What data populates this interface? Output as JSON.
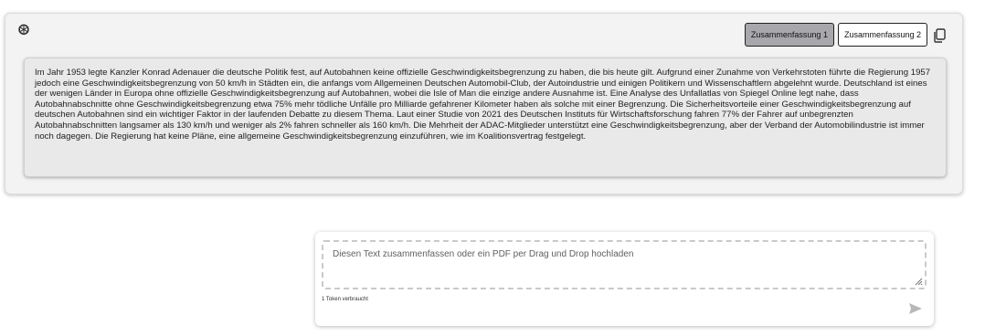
{
  "header": {
    "logo_icon": "openai-logo-icon",
    "tabs": [
      {
        "label": "Zusammenfassung 1",
        "active": true
      },
      {
        "label": "Zusammenfassung 2",
        "active": false
      }
    ],
    "copy_icon": "copy-icon"
  },
  "summary": {
    "text": "Im Jahr 1953 legte Kanzler Konrad Adenauer die deutsche Politik fest, auf Autobahnen keine offizielle Geschwindigkeitsbegrenzung zu haben, die bis heute gilt. Aufgrund einer Zunahme von Verkehrstoten führte die Regierung 1957 jedoch eine Geschwindigkeitsbegrenzung von 50 km/h in Städten ein, die anfangs vom Allgemeinen Deutschen Automobil-Club, der Autoindustrie und einigen Politikern und Wissenschaftlern abgelehnt wurde. Deutschland ist eines der wenigen Länder in Europa ohne offizielle Geschwindigkeitsbegrenzung auf Autobahnen, wobei die Isle of Man die einzige andere Ausnahme ist. Eine Analyse des Unfallatlas von Spiegel Online legt nahe, dass Autobahnabschnitte ohne Geschwindigkeitsbegrenzung etwa 75% mehr tödliche Unfälle pro Milliarde gefahrener Kilometer haben als solche mit einer Begrenzung. Die Sicherheitsvorteile einer Geschwindigkeitsbegrenzung auf deutschen Autobahnen sind ein wichtiger Faktor in der laufenden Debatte zu diesem Thema. Laut einer Studie von 2021 des Deutschen Instituts für Wirtschaftsforschung fahren 77% der Fahrer auf unbegrenzten Autobahnabschnitten langsamer als 130 km/h und weniger als 2% fahren schneller als 160 km/h. Die Mehrheit der ADAC-Mitglieder unterstützt eine Geschwindigkeitsbegrenzung, aber der Verband der Automobilindustrie ist immer noch dagegen. Die Regierung hat keine Pläne, eine allgemeine Geschwindigkeitsbegrenzung einzuführen, wie im Koalitionsvertrag festgelegt."
  },
  "input": {
    "value": "",
    "placeholder": "Diesen Text zusammenfassen oder ein PDF per Drag und Drop hochladen",
    "token_info": "1 Token verbraucht",
    "send_icon": "send-icon"
  },
  "colors": {
    "active_tab": "#a8a8ac",
    "summary_bg": "#e9e9e9",
    "card_bg": "#f3f3f3"
  }
}
